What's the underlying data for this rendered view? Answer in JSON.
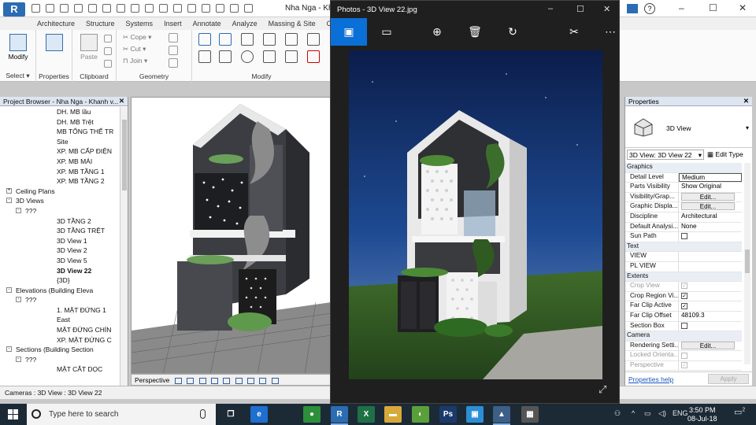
{
  "revit": {
    "logo": "R",
    "title": "Nha Nga - Khan",
    "ribbon_tabs": [
      "Architecture",
      "Structure",
      "Systems",
      "Insert",
      "Annotate",
      "Analyze",
      "Massing & Site",
      "Collabo"
    ],
    "groups": {
      "select": "Select",
      "properties": "Properties",
      "clipboard": "Clipboard",
      "geometry": "Geometry",
      "modify": "Modify"
    },
    "modify_label": "Modify",
    "properties_btn_label": "Properties",
    "clipboard_buttons": [
      "Paste"
    ],
    "geometry_buttons": [
      "Cope",
      "Cut",
      "Join"
    ],
    "status_text": "Cameras : 3D View : 3D View 22",
    "view_bar_label": "Perspective"
  },
  "project_browser": {
    "title": "Project Browser - Nha Nga - Khanh v...",
    "items": [
      {
        "label": "DH. MB lầu",
        "indent": 3,
        "toggle": ""
      },
      {
        "label": "DH. MB Trệt",
        "indent": 3,
        "toggle": ""
      },
      {
        "label": "MB TỔNG THỂ TR",
        "indent": 3,
        "toggle": ""
      },
      {
        "label": "Site",
        "indent": 3,
        "toggle": ""
      },
      {
        "label": "XP. MB CẤP ĐIỆN",
        "indent": 3,
        "toggle": ""
      },
      {
        "label": "XP. MB MÁI",
        "indent": 3,
        "toggle": ""
      },
      {
        "label": "XP. MB TẦNG 1",
        "indent": 3,
        "toggle": ""
      },
      {
        "label": "XP. MB TẦNG 2",
        "indent": 3,
        "toggle": ""
      },
      {
        "label": "Ceiling Plans",
        "indent": 1,
        "toggle": "+"
      },
      {
        "label": "3D Views",
        "indent": 1,
        "toggle": "-"
      },
      {
        "label": "???",
        "indent": 2,
        "toggle": "-"
      },
      {
        "label": "3D TẦNG 2",
        "indent": 3,
        "toggle": ""
      },
      {
        "label": "3D TẦNG TRỆT",
        "indent": 3,
        "toggle": ""
      },
      {
        "label": "3D View 1",
        "indent": 3,
        "toggle": ""
      },
      {
        "label": "3D View 2",
        "indent": 3,
        "toggle": ""
      },
      {
        "label": "3D View 5",
        "indent": 3,
        "toggle": ""
      },
      {
        "label": "3D View 22",
        "indent": 3,
        "toggle": "",
        "bold": true
      },
      {
        "label": "{3D}",
        "indent": 3,
        "toggle": ""
      },
      {
        "label": "Elevations (Building Eleva",
        "indent": 1,
        "toggle": "-"
      },
      {
        "label": "???",
        "indent": 2,
        "toggle": "-"
      },
      {
        "label": "1. MẶT ĐỨNG 1",
        "indent": 3,
        "toggle": ""
      },
      {
        "label": "East",
        "indent": 3,
        "toggle": ""
      },
      {
        "label": "MẶT ĐỨNG CHÍN",
        "indent": 3,
        "toggle": ""
      },
      {
        "label": "XP. MẶT ĐỨNG C",
        "indent": 3,
        "toggle": ""
      },
      {
        "label": "Sections (Building Section",
        "indent": 1,
        "toggle": "-"
      },
      {
        "label": "???",
        "indent": 2,
        "toggle": "-"
      },
      {
        "label": "MẶT CẮT DỌC",
        "indent": 3,
        "toggle": ""
      }
    ]
  },
  "photos": {
    "title": "Photos - 3D View 22.jpg",
    "tools": [
      {
        "icon": "image-icon",
        "glyph": "▣"
      },
      {
        "icon": "slideshow-icon",
        "glyph": "▭"
      },
      {
        "icon": "zoom-icon",
        "glyph": "⊕"
      },
      {
        "icon": "delete-icon",
        "glyph": "🗑"
      },
      {
        "icon": "rotate-icon",
        "glyph": "↻"
      },
      {
        "icon": "edit-icon",
        "glyph": "✂"
      },
      {
        "icon": "more-icon",
        "glyph": "⋯"
      }
    ]
  },
  "properties": {
    "title": "Properties",
    "type_name": "3D View",
    "instance_selector": "3D View: 3D View 22",
    "edit_type": "Edit Type",
    "rows": [
      {
        "kind": "section",
        "name": "Graphics"
      },
      {
        "kind": "text",
        "name": "Detail Level",
        "value": "Medium"
      },
      {
        "kind": "text",
        "name": "Parts Visibility",
        "value": "Show Original"
      },
      {
        "kind": "button",
        "name": "Visibility/Grap...",
        "value": "Edit..."
      },
      {
        "kind": "button",
        "name": "Graphic Displa...",
        "value": "Edit..."
      },
      {
        "kind": "text",
        "name": "Discipline",
        "value": "Architectural"
      },
      {
        "kind": "text",
        "name": "Default Analysi...",
        "value": "None"
      },
      {
        "kind": "check",
        "name": "Sun Path",
        "value": ""
      },
      {
        "kind": "section",
        "name": "Text"
      },
      {
        "kind": "text",
        "name": "VIEW",
        "value": ""
      },
      {
        "kind": "text",
        "name": "PL VIEW",
        "value": ""
      },
      {
        "kind": "section",
        "name": "Extents"
      },
      {
        "kind": "check-dim",
        "name": "Crop View",
        "value": "on",
        "grey": true
      },
      {
        "kind": "check",
        "name": "Crop Region Vi...",
        "value": "on"
      },
      {
        "kind": "check",
        "name": "Far Clip Active",
        "value": "on"
      },
      {
        "kind": "text",
        "name": "Far Clip Offset",
        "value": "48109.3"
      },
      {
        "kind": "check",
        "name": "Section Box",
        "value": ""
      },
      {
        "kind": "section",
        "name": "Camera"
      },
      {
        "kind": "button",
        "name": "Rendering Setti...",
        "value": "Edit..."
      },
      {
        "kind": "check-dim",
        "name": "Locked Orienta...",
        "value": "",
        "grey": true
      },
      {
        "kind": "check-dim",
        "name": "Perspective",
        "value": "on",
        "grey": true
      }
    ],
    "help_link": "Properties help",
    "apply": "Apply"
  },
  "taskbar": {
    "search_placeholder": "Type here to search",
    "apps": [
      {
        "icon": "task-view-icon",
        "glyph": "❐",
        "color": "#1c2a36"
      },
      {
        "icon": "edge-icon",
        "glyph": "e",
        "color": "#1e6fd0"
      },
      {
        "icon": "chrome-icon",
        "glyph": "●",
        "color": "#2d8f3a"
      },
      {
        "icon": "revit-icon",
        "glyph": "R",
        "color": "#2b6cb3"
      },
      {
        "icon": "excel-icon",
        "glyph": "X",
        "color": "#1e7145"
      },
      {
        "icon": "explorer-icon",
        "glyph": "▬",
        "color": "#d8a93a"
      },
      {
        "icon": "app-icon",
        "glyph": "◐",
        "color": "#5aa03a"
      },
      {
        "icon": "photoshop-icon",
        "glyph": "Ps",
        "color": "#1a3a6b"
      },
      {
        "icon": "remote-icon",
        "glyph": "▣",
        "color": "#2b8fd6"
      },
      {
        "icon": "photos-icon",
        "glyph": "▲",
        "color": "#3c5f86"
      },
      {
        "icon": "calculator-icon",
        "glyph": "▦",
        "color": "#555"
      }
    ],
    "lang": "ENG",
    "time": "3:50 PM",
    "date": "08-Jul-18",
    "notification_count": "2"
  },
  "colors": {
    "accent": "#0a6fd6",
    "taskbar": "#1c2a36",
    "revit_blue": "#2b6cb3"
  }
}
